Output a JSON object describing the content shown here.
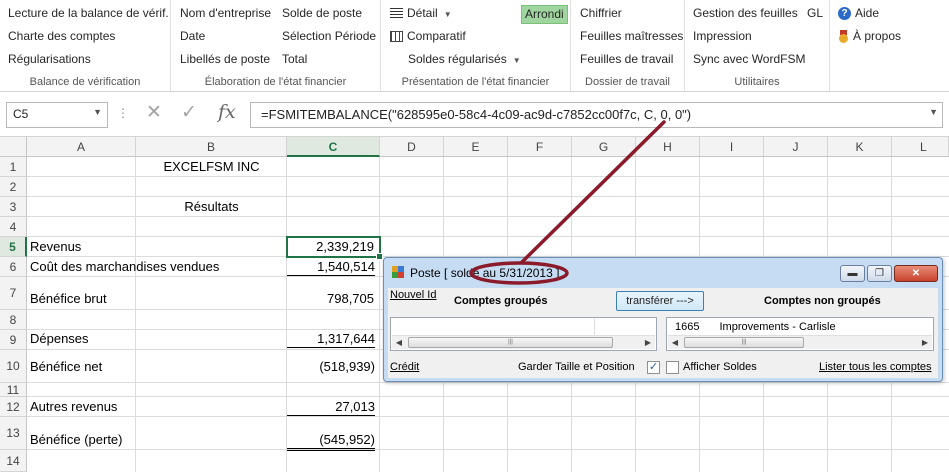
{
  "ribbon": {
    "groups": [
      {
        "label": "Balance de vérification",
        "items": [
          "Lecture de la balance de vérif.",
          "Charte des comptes",
          "Régularisations"
        ]
      },
      {
        "label": "Élaboration de l'état financier",
        "col1": [
          "Nom d'entreprise",
          "Date",
          "Libellés de poste"
        ],
        "col2": [
          "Solde de poste",
          "Sélection Période",
          "Total"
        ]
      },
      {
        "label": "Présentation de l'état financier",
        "detail": "Détail",
        "arrondi": "Arrondi",
        "comparatif": "Comparatif",
        "soldes": "Soldes régularisés"
      },
      {
        "label": "Dossier de travail",
        "items": [
          "Chiffrier",
          "Feuilles maîtresses",
          "Feuilles de travail"
        ]
      },
      {
        "label": "Utilitaires",
        "items": [
          "Gestion des feuilles",
          "Impression",
          "Sync avec WordFSM"
        ],
        "gl": "GL"
      },
      {
        "items": [
          "Aide",
          "À propos"
        ]
      }
    ]
  },
  "formula_bar": {
    "name_box": "C5",
    "formula": "=FSMITEMBALANCE(\"628595e0-58c4-4c09-ac9d-c7852cc00f7c, C, 0, 0\")",
    "fx": "fx"
  },
  "grid": {
    "columns": [
      "A",
      "B",
      "C",
      "D",
      "E",
      "F",
      "G",
      "H",
      "I",
      "J",
      "K",
      "L"
    ],
    "rows": [
      "1",
      "2",
      "3",
      "4",
      "5",
      "6",
      "7",
      "8",
      "9",
      "10",
      "11",
      "12",
      "13",
      "14"
    ],
    "selected_cell": "C5",
    "cells": {
      "b1": "EXCELFSM INC",
      "b3": "Résultats",
      "a5": "Revenus",
      "c5": "2,339,219",
      "a6": "Coût des marchandises vendues",
      "c6": "1,540,514",
      "a7": "Bénéfice brut",
      "c7": "798,705",
      "a9": "Dépenses",
      "c9": "1,317,644",
      "a10": "Bénéfice net",
      "c10": "(518,939)",
      "a12": "Autres revenus",
      "c12": "27,013",
      "a13": "Bénéfice (perte)",
      "c13": "(545,952)"
    }
  },
  "dialog": {
    "title": "Poste  [ solde au 5/31/2013 ]",
    "nouvel_id": "Nouvel Id",
    "grouped_header": "Comptes groupés",
    "transfer_button": "transférer --->",
    "ungrouped_header": "Comptes non groupés",
    "ungrouped_list": [
      {
        "code": "1665",
        "name": "Improvements - Carlisle"
      }
    ],
    "credit_link": "Crédit",
    "keep_size_label": "Garder Taille et Position",
    "keep_size_checked": true,
    "show_balances_label": "Afficher Soldes",
    "show_balances_checked": false,
    "list_all_link": "Lister tous les comptes"
  },
  "colors": {
    "accent": "#217346",
    "annotation": "#8b1a2b",
    "arrondi_highlight": "#9fd59f"
  }
}
